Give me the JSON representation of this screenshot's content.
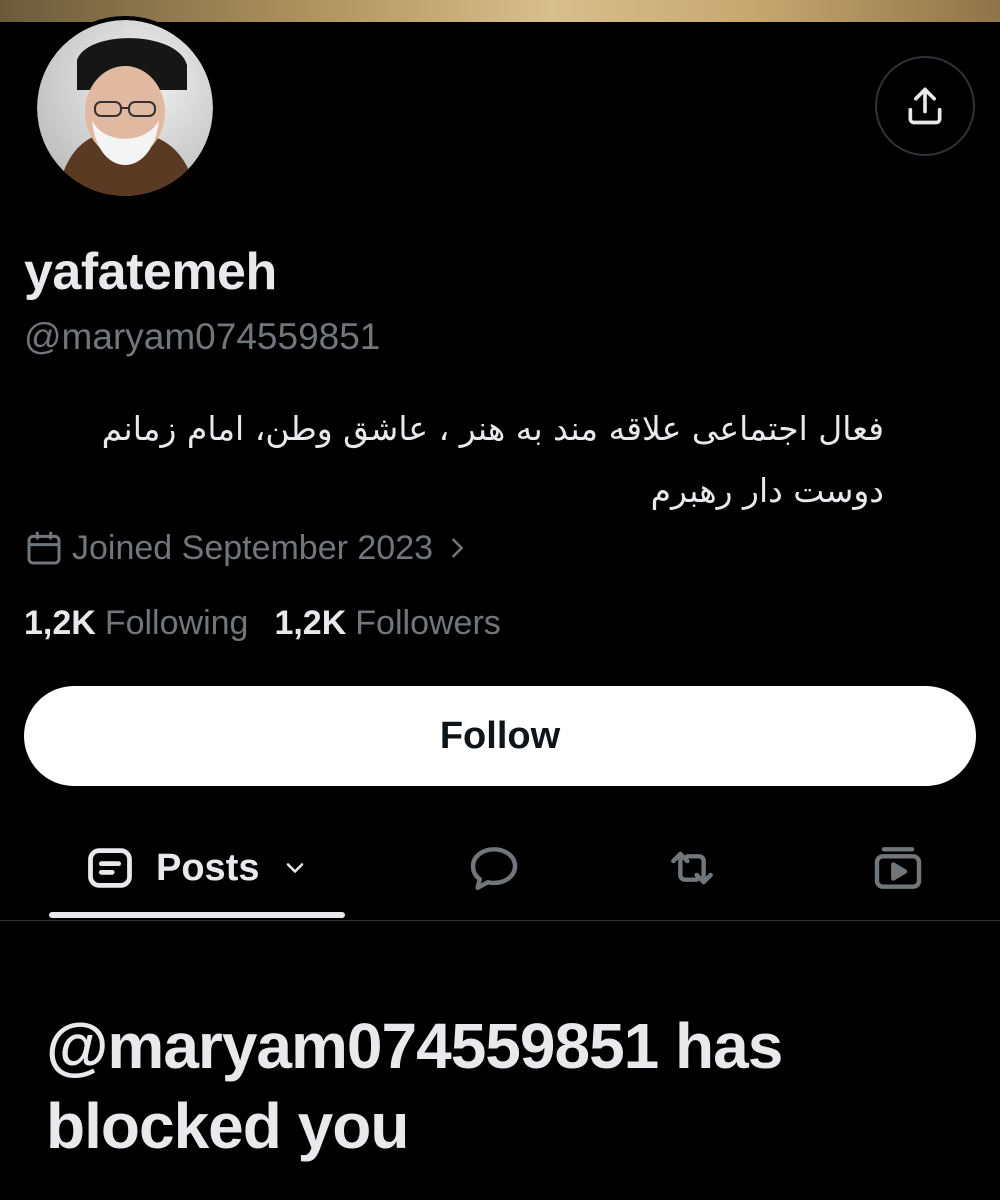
{
  "profile": {
    "display_name": "yafatemeh",
    "handle": "@maryam074559851",
    "bio_line1": "فعال اجتماعی علاقه مند به هنر ، عاشق وطن، امام زمانم",
    "bio_line2": "دوست دار رهبرم",
    "joined": "Joined September 2023",
    "following_count": "1,2K",
    "following_label": "Following",
    "followers_count": "1,2K",
    "followers_label": "Followers"
  },
  "actions": {
    "follow_label": "Follow",
    "share_icon": "share-icon"
  },
  "tabs": {
    "posts_label": "Posts",
    "active": "posts",
    "icons": [
      "posts-icon",
      "replies-icon",
      "reposts-icon",
      "media-icon"
    ]
  },
  "blocked_message": "@maryam074559851 has blocked you",
  "colors": {
    "background": "#000000",
    "primary_text": "#e7e9ea",
    "secondary_text": "#71767b",
    "follow_button_bg": "#ffffff",
    "divider": "#2f3336"
  }
}
